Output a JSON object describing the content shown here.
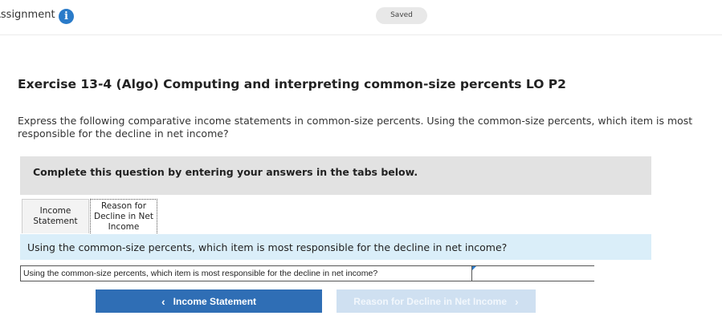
{
  "header": {
    "app_title": "Assignment",
    "info_icon": "i",
    "status": "Saved"
  },
  "exercise": {
    "title": "Exercise 13-4 (Algo) Computing and interpreting common-size percents LO P2",
    "prompt": "Express the following comparative income statements in common-size percents. Using the common-size percents, which item is most responsible for the decline in net income?",
    "instructions": "Complete this question by entering your answers in the tabs below."
  },
  "tabs": [
    {
      "label": "Income Statement"
    },
    {
      "label": "Reason for Decline in Net Income",
      "active": true
    }
  ],
  "question": {
    "text": "Using the common-size percents, which item is most responsible for the decline in net income?",
    "row_label": "Using the common-size percents, which item is most responsible for the decline in net income?",
    "answer_value": ""
  },
  "nav": {
    "prev_label": "Income Statement",
    "next_label": "Reason for Decline in Net Income",
    "prev_chevron": "‹",
    "next_chevron": "›"
  },
  "colors": {
    "accent": "#2f6eb5",
    "accent_disabled": "#cfe0f1",
    "info": "#2a7bc9",
    "question_band": "#daeef9"
  }
}
